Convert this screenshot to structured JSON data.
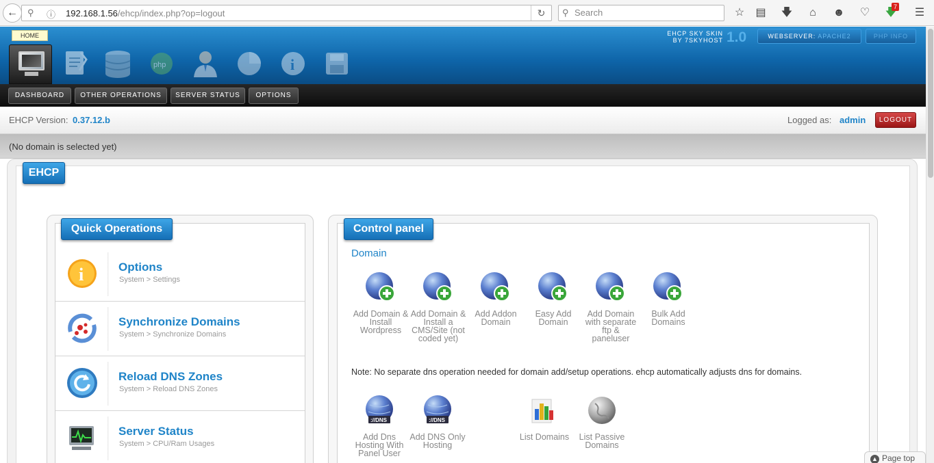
{
  "browser": {
    "url_host": "192.168.1.56",
    "url_path": "/ehcp/index.php?op=logout",
    "search_placeholder": "Search",
    "download_badge": "7"
  },
  "header": {
    "home_tooltip": "HOME",
    "skin_line1": "EHCP SKY SKIN",
    "skin_line2": "BY 7SKYHOST",
    "skin_version": "1.0",
    "webserver_label": "WEBSERVER:",
    "webserver_value": "APACHE2",
    "phpinfo_label": "PHP INFO"
  },
  "nav": {
    "dashboard": "DASHBOARD",
    "other_operations": "OTHER OPERATIONS",
    "server_status": "SERVER STATUS",
    "options": "OPTIONS"
  },
  "info": {
    "version_label": "EHCP Version:",
    "version_value": "0.37.12.b",
    "logged_label": "Logged as:",
    "logged_user": "admin",
    "logout_label": "LOGOUT",
    "domain_status": "(No domain is selected yet)"
  },
  "main": {
    "ehcp_tab": "EHCP",
    "quick_ops": {
      "title": "Quick Operations",
      "items": [
        {
          "title": "Options",
          "subtitle": "System > Settings"
        },
        {
          "title": "Synchronize Domains",
          "subtitle": "System > Synchronize Domains"
        },
        {
          "title": "Reload DNS Zones",
          "subtitle": "System > Reload DNS Zones"
        },
        {
          "title": "Server Status",
          "subtitle": "System > CPU/Ram Usages"
        }
      ]
    },
    "control_panel": {
      "title": "Control panel",
      "domain_heading": "Domain",
      "domain_items": [
        {
          "label": "Add Domain & Install Wordpress",
          "icon": "globe-add-icon"
        },
        {
          "label": "Add Domain & Install a CMS/Site (not coded yet)",
          "icon": "globe-add-icon"
        },
        {
          "label": "Add Addon Domain",
          "icon": "globe-add-icon"
        },
        {
          "label": "Easy Add Domain",
          "icon": "globe-add-icon"
        },
        {
          "label": "Add Domain with separate ftp & paneluser",
          "icon": "globe-add-icon"
        },
        {
          "label": "Bulk Add Domains",
          "icon": "globe-add-icon"
        }
      ],
      "note": "Note: No separate dns operation needed for domain add/setup operations. ehcp automatically adjusts dns for domains.",
      "dns_items": [
        {
          "label": "Add Dns Hosting With Panel User",
          "icon": "dns-globe-icon",
          "badge": "://DNS"
        },
        {
          "label": "Add DNS Only Hosting",
          "icon": "dns-globe-icon",
          "badge": "://DNS"
        },
        {
          "label": "List Domains",
          "icon": "bar-chart-icon"
        },
        {
          "label": "List Passive Domains",
          "icon": "grey-globe-icon"
        }
      ]
    }
  },
  "footer": {
    "page_top": "Page top"
  }
}
